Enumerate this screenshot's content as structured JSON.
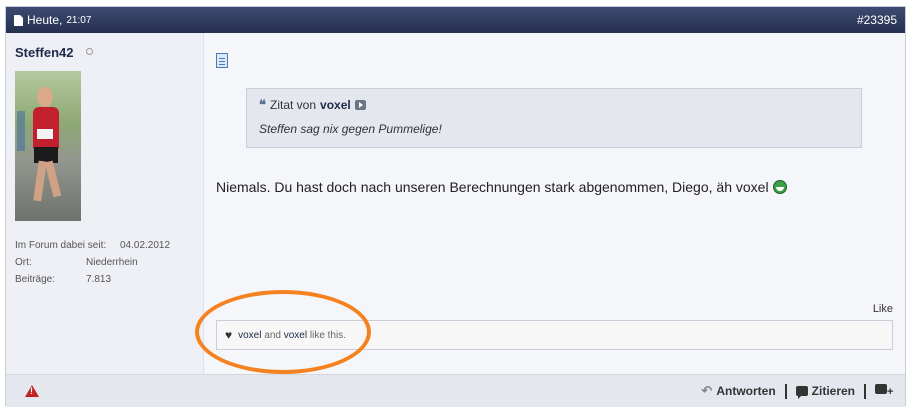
{
  "header": {
    "date": "Heute,",
    "time": "21:07",
    "post_number": "#23395"
  },
  "user": {
    "name": "Steffen42",
    "stats": [
      {
        "label": "Im Forum dabei seit:",
        "value": "04.02.2012"
      },
      {
        "label": "Ort:",
        "value": "Niederrhein"
      },
      {
        "label": "Beiträge:",
        "value": "7.813"
      }
    ]
  },
  "quote": {
    "prefix": "Zitat von",
    "user": "voxel",
    "text": "Steffen sag nix gegen Pummelige!"
  },
  "message": "Niemals. Du hast doch nach unseren Berechnungen stark abgenommen, Diego, äh voxel",
  "likes": {
    "like_label": "Like",
    "user1": "voxel",
    "and": "and",
    "user2": "voxel",
    "suffix": "like this."
  },
  "footer": {
    "reply": "Antworten",
    "quote": "Zitieren"
  },
  "colors": {
    "header_bg": "#2f3a5c",
    "highlight": "#f58220",
    "warning": "#c42121"
  }
}
